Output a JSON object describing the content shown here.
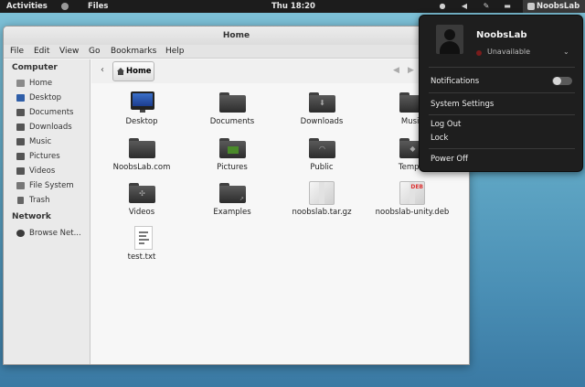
{
  "topbar": {
    "activities": "Activities",
    "app_name": "Files",
    "clock": "Thu 18:20",
    "user": "NoobsLab"
  },
  "window": {
    "title": "Home",
    "menu": [
      "File",
      "Edit",
      "View",
      "Go",
      "Bookmarks",
      "Help"
    ]
  },
  "sidebar": {
    "computer_heading": "Computer",
    "computer_items": [
      "Home",
      "Desktop",
      "Documents",
      "Downloads",
      "Music",
      "Pictures",
      "Videos",
      "File System",
      "Trash"
    ],
    "network_heading": "Network",
    "network_items": [
      "Browse Net..."
    ]
  },
  "toolbar": {
    "breadcrumb": "Home"
  },
  "files": [
    {
      "name": "Desktop",
      "kind": "monitor"
    },
    {
      "name": "Documents",
      "kind": "folder"
    },
    {
      "name": "Downloads",
      "kind": "folder-download"
    },
    {
      "name": "Music",
      "kind": "folder"
    },
    {
      "name": "NoobsLab.com",
      "kind": "folder"
    },
    {
      "name": "Pictures",
      "kind": "folder-pictures"
    },
    {
      "name": "Public",
      "kind": "folder-public"
    },
    {
      "name": "Templa",
      "kind": "folder"
    },
    {
      "name": "Videos",
      "kind": "folder-videos"
    },
    {
      "name": "Examples",
      "kind": "folder-link"
    },
    {
      "name": "noobslab.tar.gz",
      "kind": "archive"
    },
    {
      "name": "noobslab-unity.deb",
      "kind": "deb"
    },
    {
      "name": "test.txt",
      "kind": "text"
    }
  ],
  "user_menu": {
    "name": "NoobsLab",
    "status": "Unavailable",
    "notifications_label": "Notifications",
    "notifications_on": false,
    "system_settings": "System Settings",
    "log_out": "Log Out",
    "lock": "Lock",
    "power_off": "Power Off"
  }
}
